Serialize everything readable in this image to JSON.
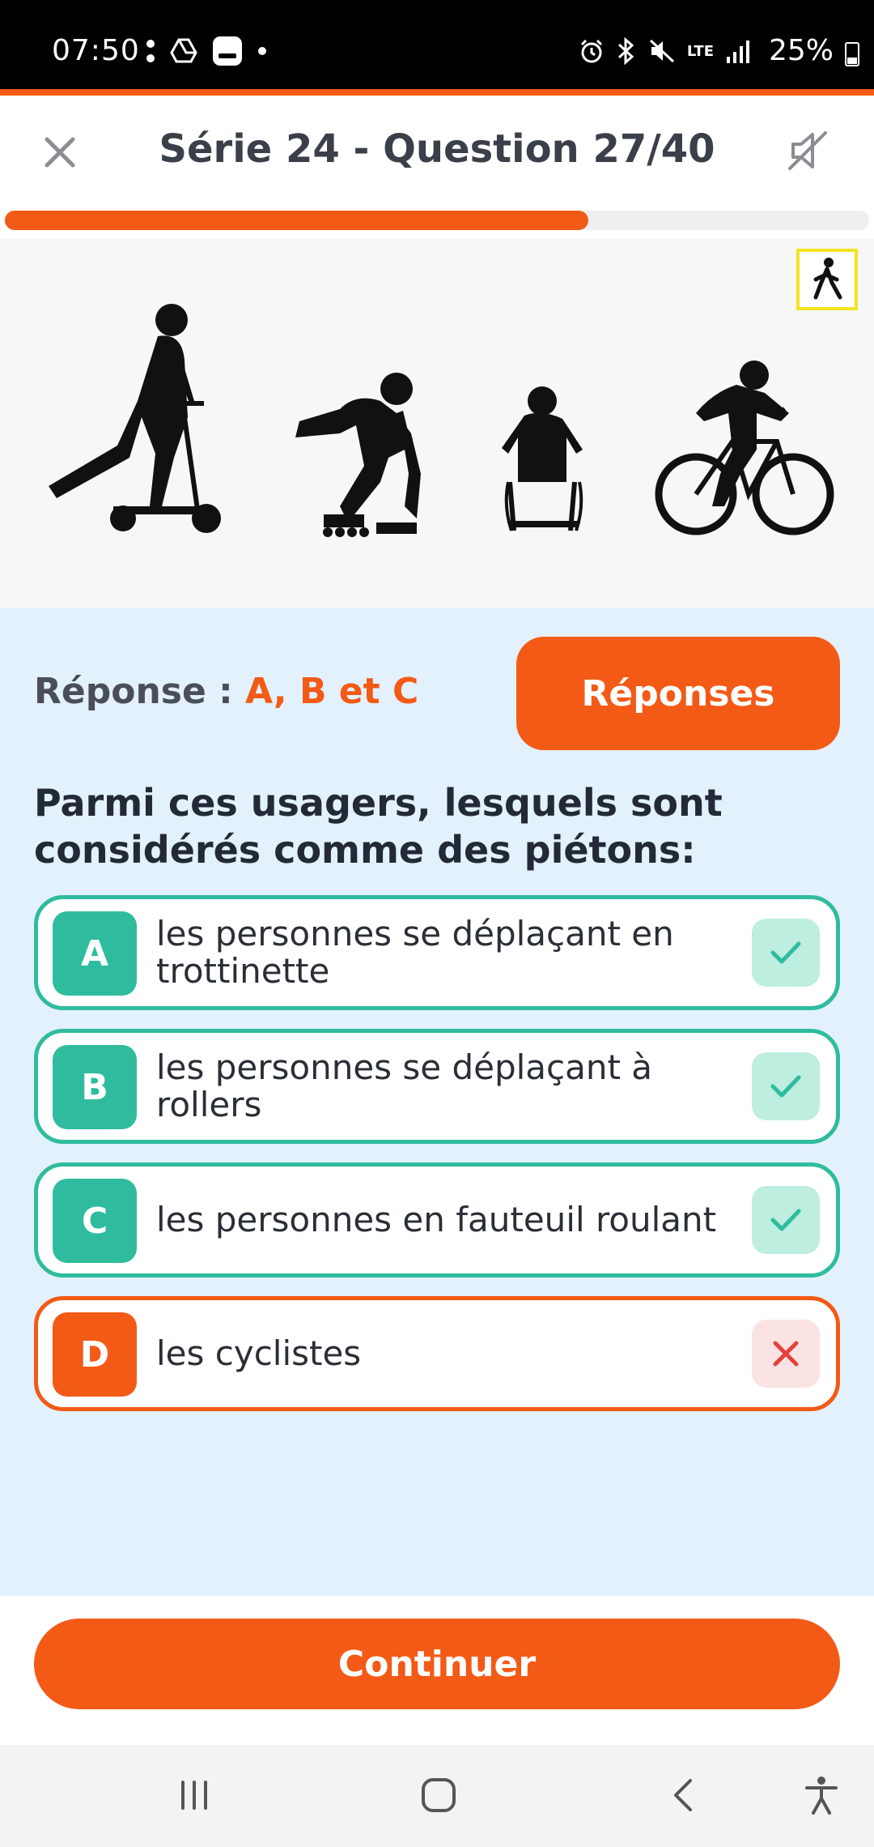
{
  "status_bar": {
    "time": "07:50",
    "battery": "25%",
    "network": "LTE"
  },
  "header": {
    "title": "Série 24 - Question 27/40",
    "close_icon": "close-icon",
    "mute_icon": "sound-off-icon"
  },
  "progress": {
    "fraction": 0.675
  },
  "illustration": {
    "figures": [
      "scooter-rider",
      "roller-skater",
      "wheelchair-user",
      "cyclist"
    ],
    "sign_icon": "pedestrian-sign-icon"
  },
  "answer": {
    "label": "Réponse : ",
    "value": "A, B et C",
    "button_label": "Réponses"
  },
  "question": "Parmi ces usagers, lesquels sont considérés comme des piétons:",
  "options": [
    {
      "letter": "A",
      "text": "les personnes se déplaçant en trottinette",
      "correct": true
    },
    {
      "letter": "B",
      "text": "les personnes se déplaçant à rollers",
      "correct": true
    },
    {
      "letter": "C",
      "text": "les personnes en fauteuil roulant",
      "correct": true
    },
    {
      "letter": "D",
      "text": "les cyclistes",
      "correct": false
    }
  ],
  "continue_label": "Continuer",
  "colors": {
    "accent": "#f35a16",
    "correct": "#2fbc9e",
    "panel": "#e2f1fc"
  }
}
